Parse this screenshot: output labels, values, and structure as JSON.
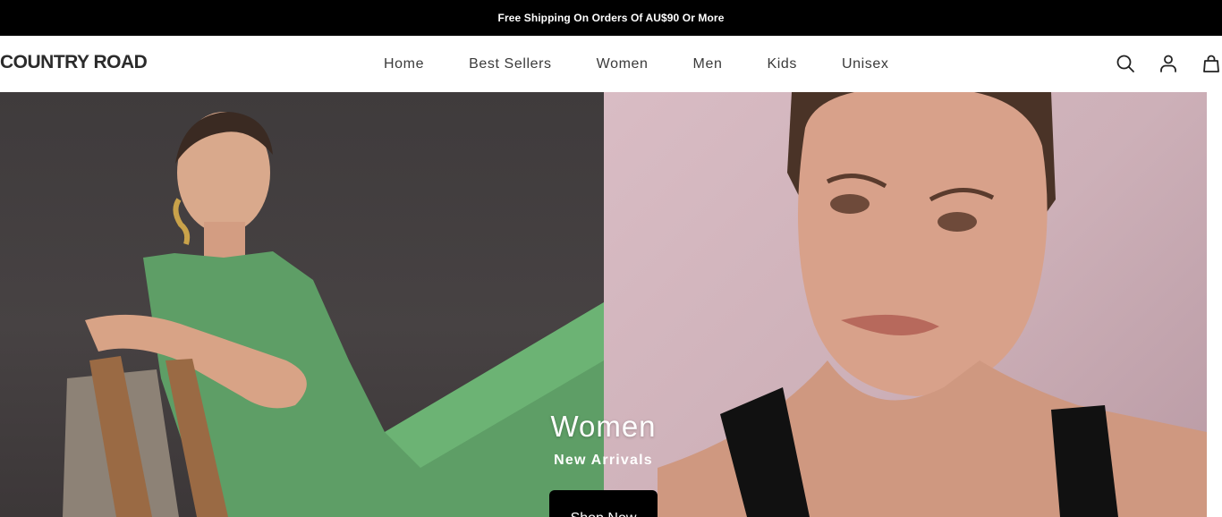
{
  "announcement": "Free Shipping On Orders Of AU$90 Or More",
  "brand": "COUNTRY ROAD",
  "nav": [
    "Home",
    "Best Sellers",
    "Women",
    "Men",
    "Kids",
    "Unisex"
  ],
  "header_icons": [
    "search-icon",
    "account-icon",
    "cart-icon"
  ],
  "hero": {
    "title": "Women",
    "subtitle": "New Arrivals",
    "cta": "Shop Now"
  },
  "colors": {
    "announcement_bg": "#000000",
    "button_bg": "#000000",
    "left_panel_bg": "#434041",
    "right_panel_bg": "#d4b7bf"
  }
}
